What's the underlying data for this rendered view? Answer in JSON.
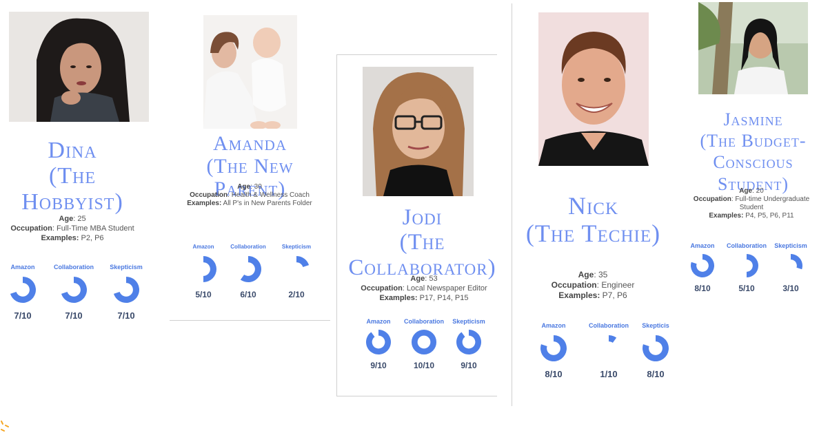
{
  "personas": [
    {
      "id": "dina",
      "name": "Dina",
      "role": "(The Hobbyist)",
      "age_label": "Age",
      "age": "25",
      "occupation_label": "Occupation",
      "occupation": "Full-Time MBA Student",
      "examples_label": "Examples:",
      "examples": "P2, P6",
      "metrics": [
        {
          "label": "Amazon",
          "score": 7,
          "value": "7/10"
        },
        {
          "label": "Collaboration",
          "score": 7,
          "value": "7/10"
        },
        {
          "label": "Skepticism",
          "score": 7,
          "value": "7/10"
        }
      ]
    },
    {
      "id": "amanda",
      "name": "Amanda",
      "role": "(The New Parent)",
      "age_label": "Age",
      "age": "30",
      "occupation_label": "Occupation",
      "occupation": "Health & Wellness Coach",
      "examples_label": "Examples:",
      "examples": "All P's in New Parents Folder",
      "metrics": [
        {
          "label": "Amazon",
          "score": 5,
          "value": "5/10"
        },
        {
          "label": "Collaboration",
          "score": 6,
          "value": "6/10"
        },
        {
          "label": "Skepticism",
          "score": 2,
          "value": "2/10"
        }
      ]
    },
    {
      "id": "jodi",
      "name": "Jodi",
      "role": "(The Collaborator)",
      "age_label": "Age",
      "age": "53",
      "occupation_label": "Occupation",
      "occupation": "Local Newspaper Editor",
      "examples_label": "Examples:",
      "examples": "P17, P14, P15",
      "metrics": [
        {
          "label": "Amazon",
          "score": 9,
          "value": "9/10"
        },
        {
          "label": "Collaboration",
          "score": 10,
          "value": "10/10"
        },
        {
          "label": "Skepticism",
          "score": 9,
          "value": "9/10"
        }
      ]
    },
    {
      "id": "nick",
      "name": "Nick",
      "role": "(The Techie)",
      "age_label": "Age",
      "age": "35",
      "occupation_label": "Occupation",
      "occupation": "Engineer",
      "examples_label": "Examples:",
      "examples": "P7, P6",
      "metrics": [
        {
          "label": "Amazon",
          "score": 8,
          "value": "8/10"
        },
        {
          "label": "Collaboration",
          "score": 1,
          "value": "1/10"
        },
        {
          "label": "Skepticis",
          "score": 8,
          "value": "8/10"
        }
      ]
    },
    {
      "id": "jasmine",
      "name": "Jasmine",
      "role_line1": "(The Budget-Conscious",
      "role_line2": "Student)",
      "age_label": "Age",
      "age": "20",
      "occupation_label": "Occupation",
      "occupation": "Full-time Undergraduate Student",
      "examples_label": "Examples:",
      "examples": "P4, P5, P6, P11",
      "metrics": [
        {
          "label": "Amazon",
          "score": 8,
          "value": "8/10"
        },
        {
          "label": "Collaboration",
          "score": 5,
          "value": "5/10"
        },
        {
          "label": "Skepticism",
          "score": 3,
          "value": "3/10"
        }
      ]
    }
  ],
  "colors": {
    "accent": "#6f8ff0",
    "donut": "#4f80e8",
    "donut_track": "#ffffff"
  }
}
